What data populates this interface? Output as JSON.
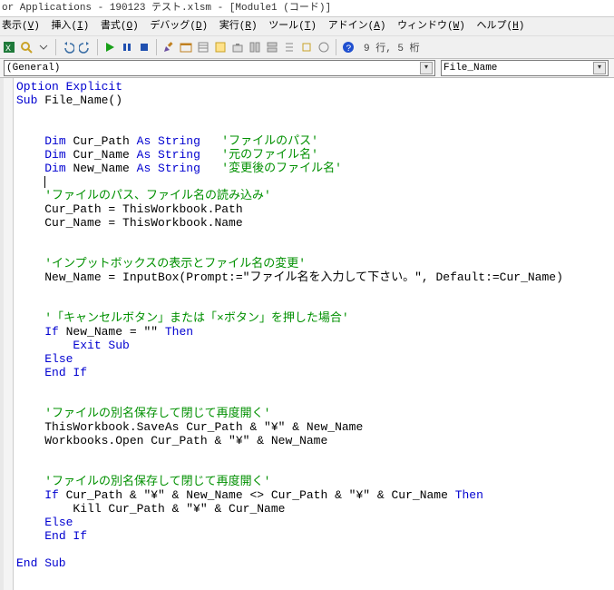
{
  "title": "or Applications - 190123 テスト.xlsm - [Module1 (コード)]",
  "menu": {
    "view": {
      "label": "表示",
      "u": "V"
    },
    "insert": {
      "label": "挿入",
      "u": "I"
    },
    "format": {
      "label": "書式",
      "u": "O"
    },
    "debug": {
      "label": "デバッグ",
      "u": "D"
    },
    "run": {
      "label": "実行",
      "u": "R"
    },
    "tools": {
      "label": "ツール",
      "u": "T"
    },
    "addin": {
      "label": "アドイン",
      "u": "A"
    },
    "window": {
      "label": "ウィンドウ",
      "u": "W"
    },
    "help": {
      "label": "ヘルプ",
      "u": "H"
    }
  },
  "toolbar_status": "9 行, 5 桁",
  "dropdown_left": "(General)",
  "dropdown_right": "File_Name",
  "code": {
    "l1_a": "Option Explicit",
    "l2_a": "Sub ",
    "l2_b": "File_Name()",
    "l5_a": "Dim ",
    "l5_b": "Cur_Path ",
    "l5_c": "As String   ",
    "l5_d": "'ファイルのパス'",
    "l6_a": "Dim ",
    "l6_b": "Cur_Name ",
    "l6_c": "As String   ",
    "l6_d": "'元のファイル名'",
    "l7_a": "Dim ",
    "l7_b": "New_Name ",
    "l7_c": "As String   ",
    "l7_d": "'変更後のファイル名'",
    "l10_a": "'ファイルのパス、ファイル名の読み込み'",
    "l11_a": "Cur_Path = ThisWorkbook.Path",
    "l12_a": "Cur_Name = ThisWorkbook.Name",
    "l15_a": "'インプットボックスの表示とファイル名の変更'",
    "l16_a": "New_Name = InputBox(Prompt:=\"ファイル名を入力して下さい。\", Default:=Cur_Name)",
    "l19_a": "'「キャンセルボタン」または「×ボタン」を押した場合'",
    "l20_a": "If ",
    "l20_b": "New_Name = \"\" ",
    "l20_c": "Then",
    "l21_a": "Exit Sub",
    "l22_a": "Else",
    "l23_a": "End If",
    "l26_a": "'ファイルの別名保存して閉じて再度開く'",
    "l27_a": "ThisWorkbook.SaveAs Cur_Path & \"¥\" & New_Name",
    "l28_a": "Workbooks.Open Cur_Path & \"¥\" & New_Name",
    "l31_a": "'ファイルの別名保存して閉じて再度開く'",
    "l32_a": "If ",
    "l32_b": "Cur_Path & \"¥\" & New_Name <> Cur_Path & \"¥\" & Cur_Name ",
    "l32_c": "Then",
    "l33_a": "Kill Cur_Path & \"¥\" & Cur_Name",
    "l34_a": "Else",
    "l35_a": "End If",
    "l37_a": "End Sub"
  },
  "icons": {
    "excel": "#1f7a3a",
    "find": "#c9a227",
    "arrow": "#555",
    "undo": "#3a6ea5",
    "redo": "#3a6ea5",
    "play": "#18a018",
    "stop": "#2050b0",
    "reset": "#2050b0",
    "design": "#6a4ea0",
    "proj": "#c08020",
    "props": "#888",
    "browser": "#c9a227",
    "toolbox": "#888",
    "help": "#2050d0",
    "dd": "▾"
  }
}
